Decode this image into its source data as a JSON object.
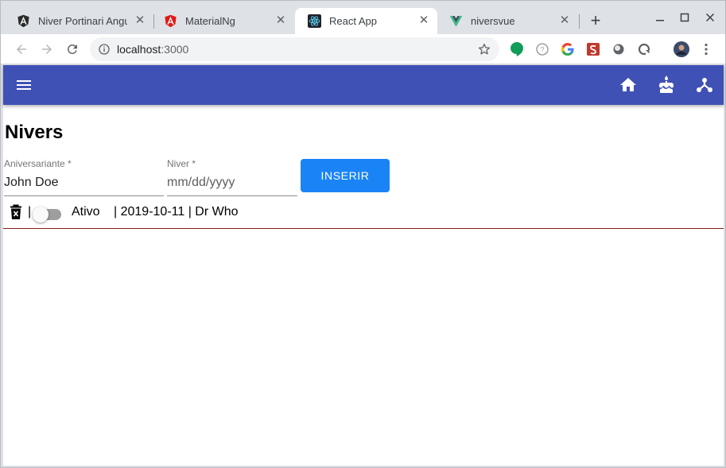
{
  "browser": {
    "tabs": [
      {
        "title": "Niver Portinari Angu",
        "icon": "angular-dark-icon"
      },
      {
        "title": "MaterialNg",
        "icon": "angular-red-icon"
      },
      {
        "title": "React App",
        "icon": "react-icon",
        "active": true
      },
      {
        "title": "niversvue",
        "icon": "vue-icon"
      }
    ],
    "tab_close": "✕",
    "new_tab": "+",
    "url_host": "localhost",
    "url_port": ":3000"
  },
  "app": {
    "bar_color": "#3f51b5",
    "title": "Nivers",
    "form": {
      "name_label": "Aniversariante *",
      "name_value": "John Doe",
      "date_label": "Niver *",
      "date_placeholder": "mm/dd/yyyy",
      "submit_label": "INSERIR",
      "submit_color": "#1a84f7"
    },
    "items": [
      {
        "separator": "|",
        "status": "Ativo",
        "details": "| 2019-10-11 | Dr Who",
        "active": false
      }
    ]
  }
}
